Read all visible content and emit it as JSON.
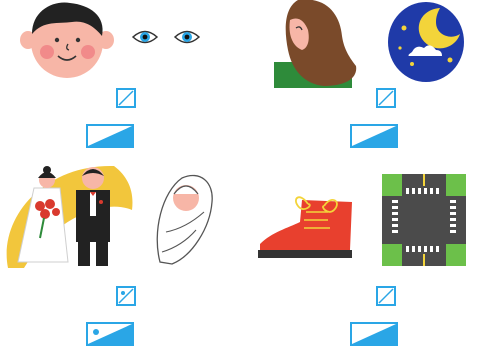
{
  "cards": [
    {
      "name": "face-eyes-card",
      "image_icons": [
        "face-icon",
        "eyes-icon"
      ],
      "control_small": "image-toggle",
      "control_wide": "image-slider"
    },
    {
      "name": "woman-night-card",
      "image_icons": [
        "woman-icon",
        "night-moon-icon"
      ],
      "control_small": "image-toggle",
      "control_wide": "image-slider"
    },
    {
      "name": "wedding-baby-card",
      "image_icons": [
        "wedding-couple-icon",
        "swaddled-baby-icon"
      ],
      "control_small": "image-toggle",
      "control_wide": "image-slider"
    },
    {
      "name": "shoe-crossroad-card",
      "image_icons": [
        "red-shoe-icon",
        "crossroad-icon"
      ],
      "control_small": "image-toggle",
      "control_wide": "image-slider"
    }
  ],
  "colors": {
    "accent": "#2aa6e6",
    "skin": "#f7b6a7",
    "cheek": "#f18a8a",
    "hair_dark": "#222222",
    "hair_brown": "#7a4a2a",
    "night_blue": "#1f3aa8",
    "moon": "#f3d43a",
    "shoe_red": "#e8402e",
    "road_gray": "#4b4b4b",
    "grass_green": "#6cc04a",
    "yellow": "#f2c63c"
  }
}
